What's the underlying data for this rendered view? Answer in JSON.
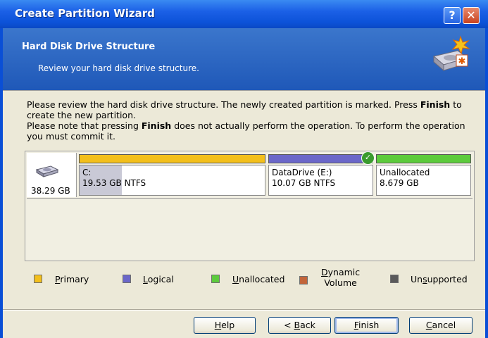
{
  "window": {
    "title": "Create Partition Wizard",
    "help_glyph": "?",
    "close_glyph": "✕"
  },
  "header": {
    "title": "Hard Disk Drive Structure",
    "subtitle": "Review your hard disk drive structure."
  },
  "description": {
    "line1_a": "Please review the hard disk drive structure. The newly created partition is marked. Press ",
    "line1_bold": "Finish",
    "line1_b": " to create the new partition.",
    "line2_a": "Please note that pressing ",
    "line2_bold": "Finish",
    "line2_b": " does not actually perform the operation. To perform the operation you must commit it."
  },
  "disk": {
    "size": "38.29 GB",
    "partitions": [
      {
        "name": "C:",
        "info": "19.53 GB  NTFS",
        "type": "Primary",
        "color": "#f3bf1b",
        "new": false
      },
      {
        "name": "DataDrive (E:)",
        "info": "10.07 GB  NTFS",
        "type": "Logical",
        "color": "#6b67c9",
        "new": true
      },
      {
        "name": "Unallocated",
        "info": "8.679 GB",
        "type": "Unallocated",
        "color": "#5ccb3c",
        "new": false
      }
    ]
  },
  "legend": [
    {
      "first": "P",
      "rest": "rimary",
      "color": "#f3bf1b"
    },
    {
      "first": "L",
      "rest": "ogical",
      "color": "#6b67c9"
    },
    {
      "first": "U",
      "rest": "nallocated",
      "color": "#5ccb3c"
    },
    {
      "first": "D",
      "rest": "ynamic",
      "line2": "Volume",
      "color": "#c2653a"
    },
    {
      "pre": "Un",
      "first": "s",
      "rest": "upported",
      "color": "#5a5a5a"
    }
  ],
  "buttons": {
    "help_first": "H",
    "help_rest": "elp",
    "back_pre": "< ",
    "back_first": "B",
    "back_rest": "ack",
    "finish_first": "F",
    "finish_rest": "inish",
    "cancel_first": "C",
    "cancel_rest": "ancel"
  }
}
